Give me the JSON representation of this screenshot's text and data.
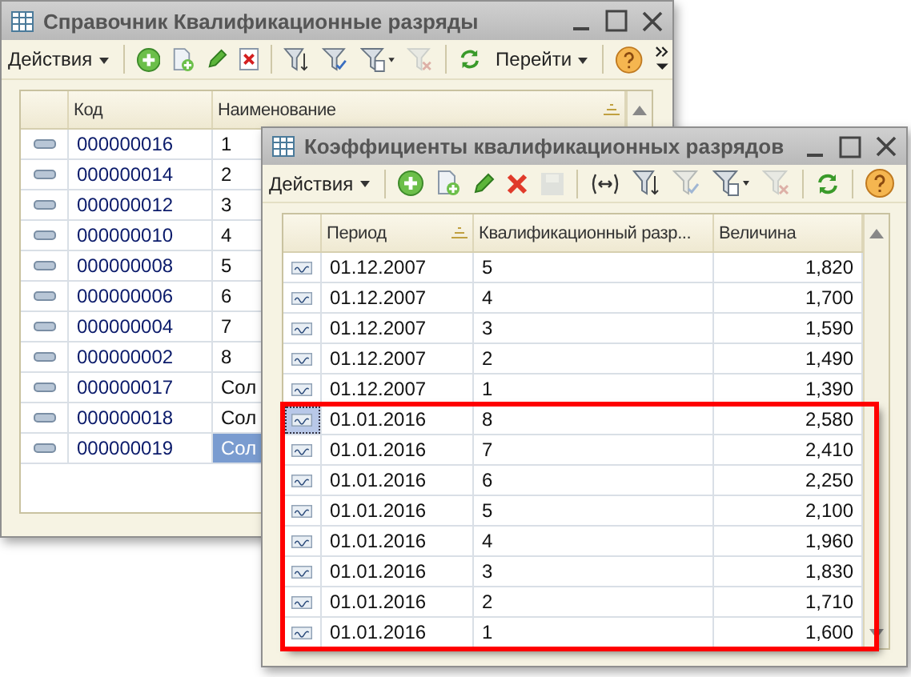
{
  "windows": [
    {
      "title": "Справочник Квалификационные разряды",
      "toolbar": [
        {
          "kind": "menu",
          "label": "Действия",
          "disabled": false
        },
        {
          "kind": "separator"
        },
        {
          "kind": "add",
          "disabled": false
        },
        {
          "kind": "copy",
          "disabled": false
        },
        {
          "kind": "edit",
          "disabled": false
        },
        {
          "kind": "delete-mark",
          "disabled": false
        },
        {
          "kind": "separator"
        },
        {
          "kind": "filter-list",
          "disabled": false
        },
        {
          "kind": "filter-check",
          "disabled": false
        },
        {
          "kind": "filter-menu",
          "disabled": false
        },
        {
          "kind": "filter-clear",
          "disabled": true
        },
        {
          "kind": "separator"
        },
        {
          "kind": "refresh",
          "disabled": false
        },
        {
          "kind": "menu",
          "label": "Перейти",
          "disabled": false
        },
        {
          "kind": "separator"
        },
        {
          "kind": "help",
          "disabled": false
        },
        {
          "kind": "more",
          "disabled": false
        }
      ],
      "table": {
        "columns": [
          {
            "kind": "icon"
          },
          {
            "label": "Код",
            "kind": "code"
          },
          {
            "label": "Наименование",
            "kind": "text",
            "sorted": true
          }
        ],
        "rows": [
          {
            "cells": [
              "",
              "000000016",
              "1"
            ],
            "selected": false
          },
          {
            "cells": [
              "",
              "000000014",
              "2"
            ],
            "selected": false
          },
          {
            "cells": [
              "",
              "000000012",
              "3"
            ],
            "selected": false
          },
          {
            "cells": [
              "",
              "000000010",
              "4"
            ],
            "selected": false
          },
          {
            "cells": [
              "",
              "000000008",
              "5"
            ],
            "selected": false
          },
          {
            "cells": [
              "",
              "000000006",
              "6"
            ],
            "selected": false
          },
          {
            "cells": [
              "",
              "000000004",
              "7"
            ],
            "selected": false
          },
          {
            "cells": [
              "",
              "000000002",
              "8"
            ],
            "selected": false
          },
          {
            "cells": [
              "",
              "000000017",
              "Сол"
            ],
            "selected": false
          },
          {
            "cells": [
              "",
              "000000018",
              "Сол"
            ],
            "selected": false
          },
          {
            "cells": [
              "",
              "000000019",
              "Сол"
            ],
            "selected": true
          }
        ]
      }
    },
    {
      "title": "Коэффициенты квалификационных разрядов",
      "toolbar": [
        {
          "kind": "menu",
          "label": "Действия",
          "disabled": false
        },
        {
          "kind": "separator"
        },
        {
          "kind": "add",
          "disabled": false
        },
        {
          "kind": "copy",
          "disabled": false
        },
        {
          "kind": "edit",
          "disabled": false
        },
        {
          "kind": "delete",
          "disabled": false
        },
        {
          "kind": "save",
          "disabled": true
        },
        {
          "kind": "separator"
        },
        {
          "kind": "range",
          "disabled": false
        },
        {
          "kind": "filter-list",
          "disabled": false
        },
        {
          "kind": "filter-check",
          "disabled": true
        },
        {
          "kind": "filter-menu",
          "disabled": false
        },
        {
          "kind": "filter-clear",
          "disabled": true
        },
        {
          "kind": "separator"
        },
        {
          "kind": "refresh",
          "disabled": false
        },
        {
          "kind": "separator"
        },
        {
          "kind": "help",
          "disabled": false
        }
      ],
      "table": {
        "columns": [
          {
            "kind": "icon"
          },
          {
            "label": "Период",
            "kind": "text",
            "sorted": true
          },
          {
            "label": "Квалификационный разр...",
            "kind": "text",
            "sorted": false
          },
          {
            "label": "Величина",
            "kind": "number",
            "sorted": false
          }
        ],
        "rows": [
          {
            "cells": [
              "",
              "01.12.2007",
              "5",
              "1,820"
            ],
            "selected": false
          },
          {
            "cells": [
              "",
              "01.12.2007",
              "4",
              "1,700"
            ],
            "selected": false
          },
          {
            "cells": [
              "",
              "01.12.2007",
              "3",
              "1,590"
            ],
            "selected": false
          },
          {
            "cells": [
              "",
              "01.12.2007",
              "2",
              "1,490"
            ],
            "selected": false
          },
          {
            "cells": [
              "",
              "01.12.2007",
              "1",
              "1,390"
            ],
            "selected": false
          }
        ],
        "highlighted_rows": [
          {
            "cells": [
              "",
              "01.01.2016",
              "8",
              "2,580"
            ],
            "selected": true
          },
          {
            "cells": [
              "",
              "01.01.2016",
              "7",
              "2,410"
            ],
            "selected": false
          },
          {
            "cells": [
              "",
              "01.01.2016",
              "6",
              "2,250"
            ],
            "selected": false
          },
          {
            "cells": [
              "",
              "01.01.2016",
              "5",
              "2,100"
            ],
            "selected": false
          },
          {
            "cells": [
              "",
              "01.01.2016",
              "4",
              "1,960"
            ],
            "selected": false
          },
          {
            "cells": [
              "",
              "01.01.2016",
              "3",
              "1,830"
            ],
            "selected": false
          },
          {
            "cells": [
              "",
              "01.01.2016",
              "2",
              "1,710"
            ],
            "selected": false
          },
          {
            "cells": [
              "",
              "01.01.2016",
              "1",
              "1,600"
            ],
            "selected": false
          }
        ]
      }
    }
  ]
}
